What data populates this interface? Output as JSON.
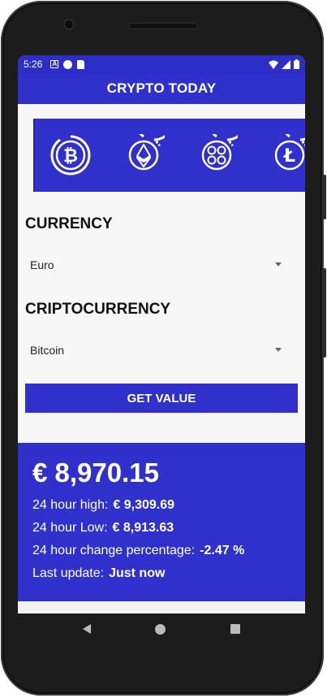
{
  "status_bar": {
    "time": "5:26",
    "icons": [
      "a-notification-icon",
      "circle-notification-icon",
      "sd-card-icon",
      "wifi-icon",
      "signal-icon",
      "battery-icon"
    ]
  },
  "app_bar": {
    "title": "CRYPTO TODAY"
  },
  "coins": [
    {
      "name": "bitcoin-icon",
      "symbol": "₿"
    },
    {
      "name": "ethereum-icon",
      "symbol": "Ξ"
    },
    {
      "name": "ripple-icon",
      "symbol": "XRP"
    },
    {
      "name": "litecoin-icon",
      "symbol": "Ł"
    }
  ],
  "form": {
    "currency_label": "CURRENCY",
    "currency_value": "Euro",
    "crypto_label": "CRIPTOCURRENCY",
    "crypto_value": "Bitcoin",
    "button_label": "GET VALUE"
  },
  "result": {
    "price": "€ 8,970.15",
    "high_label": "24 hour high:",
    "high_value": "€ 9,309.69",
    "low_label": "24 hour Low:",
    "low_value": "€ 8,913.63",
    "change_label": "24 hour change percentage:",
    "change_value": "-2.47 %",
    "update_label": "Last update:",
    "update_value": "Just now"
  },
  "colors": {
    "primary": "#3030cc",
    "status": "#2d2dc8",
    "background": "#f7f7f7"
  }
}
